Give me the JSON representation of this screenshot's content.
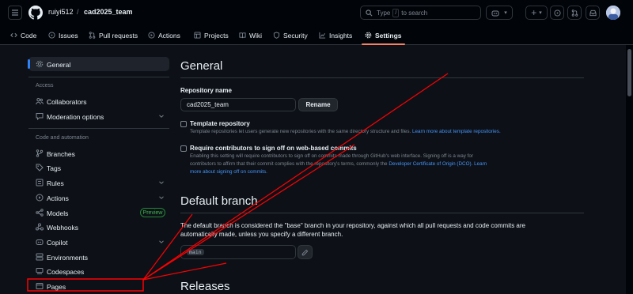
{
  "header": {
    "owner": "ruiyi512",
    "separator": "/",
    "repo": "cad2025_team",
    "search_prefix": "Type",
    "search_key": "/",
    "search_suffix": "to search"
  },
  "tabs": [
    {
      "label": "Code",
      "icon": "code-icon"
    },
    {
      "label": "Issues",
      "icon": "issue-icon"
    },
    {
      "label": "Pull requests",
      "icon": "pull-request-icon"
    },
    {
      "label": "Actions",
      "icon": "play-icon"
    },
    {
      "label": "Projects",
      "icon": "table-icon"
    },
    {
      "label": "Wiki",
      "icon": "book-icon"
    },
    {
      "label": "Security",
      "icon": "shield-icon"
    },
    {
      "label": "Insights",
      "icon": "graph-icon"
    },
    {
      "label": "Settings",
      "icon": "gear-icon",
      "active": true
    }
  ],
  "sidebar": {
    "general": "General",
    "access_title": "Access",
    "collaborators": "Collaborators",
    "moderation": "Moderation options",
    "code_title": "Code and automation",
    "branches": "Branches",
    "tags": "Tags",
    "rules": "Rules",
    "actions": "Actions",
    "models": "Models",
    "models_badge": "Preview",
    "webhooks": "Webhooks",
    "copilot": "Copilot",
    "environments": "Environments",
    "codespaces": "Codespaces",
    "pages": "Pages"
  },
  "main": {
    "title": "General",
    "repo_name_label": "Repository name",
    "repo_name_value": "cad2025_team",
    "rename_button": "Rename",
    "template_title": "Template repository",
    "template_desc": "Template repositories let users generate new repositories with the same directory structure and files.",
    "template_link": "Learn more about template repositories.",
    "signoff_title": "Require contributors to sign off on web-based commits",
    "signoff_desc_1": "Enabling this setting will require contributors to sign off on commits made through GitHub's web interface. Signing off is a way for",
    "signoff_desc_2": "contributors to affirm that their commit complies with the repository's terms, commonly the",
    "signoff_link_1": "Developer Certificate of Origin (DCO).",
    "signoff_link_2a": "Learn",
    "signoff_link_2b": "more about signing off on commits.",
    "default_branch_title": "Default branch",
    "default_branch_desc_1a": "The default branch is considered the \"base\" branch in your repository, against which all pull requests and code commits are",
    "default_branch_desc_1b": "automatically made, unless you specify a different branch.",
    "branch_value": "main",
    "releases_title": "Releases"
  },
  "colors": {
    "background": "#0d1117",
    "accent": "#f78166",
    "link": "#4493f8",
    "annotation": "#ff0000"
  }
}
